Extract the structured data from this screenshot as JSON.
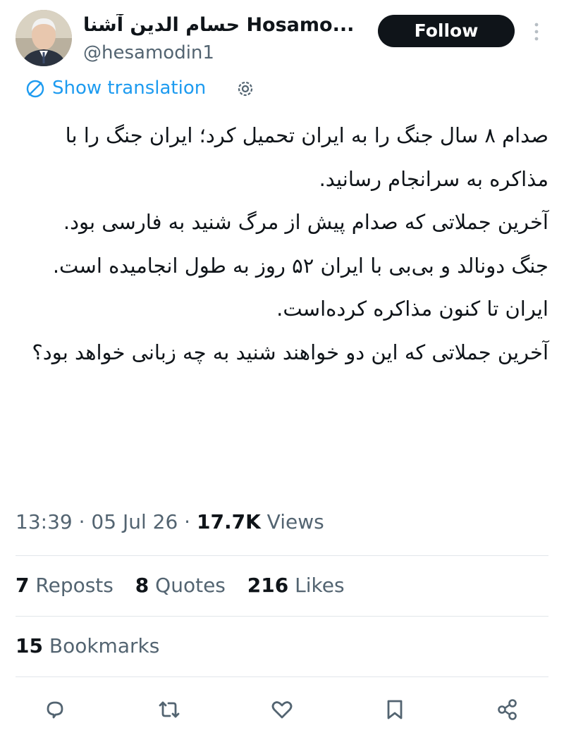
{
  "author": {
    "display_name": "حسام الدین آشنا Hosamo...",
    "handle": "@hesamodin1",
    "follow_label": "Follow",
    "avatar_icon": "avatar-photo"
  },
  "translation": {
    "label": "Show translation",
    "icon": "translate-icon",
    "settings_icon": "gear-icon",
    "color": "#1d9bf0"
  },
  "tweet": {
    "paragraphs": [
      "صدام ۸ سال جنگ را به ایران تحمیل کرد؛ ایران جنگ را با  مذاکره به سرانجام رسانید.",
      "آخرین جملاتی که صدام پیش از مرگ شنید به فارسی بود.",
      "جنگ دونالد و بی‌بی با ایران ۵۲ روز به طول انجامیده است.",
      "ایران تا کنون مذاکره کرده‌است.",
      "آخرین جملاتی که این دو خواهند شنید به چه زبانی خواهد بود؟"
    ]
  },
  "meta": {
    "time": "13:39",
    "separator": "·",
    "date": "05 Jul 26",
    "views_count": "17.7K",
    "views_label": "Views"
  },
  "stats": {
    "reposts_count": "7",
    "reposts_label": "Reposts",
    "quotes_count": "8",
    "quotes_label": "Quotes",
    "likes_count": "216",
    "likes_label": "Likes",
    "bookmarks_count": "15",
    "bookmarks_label": "Bookmarks"
  },
  "actions": [
    "reply-icon",
    "repost-icon",
    "like-icon",
    "bookmark-icon",
    "share-icon"
  ],
  "colors": {
    "text": "#0f1419",
    "secondary": "#536471",
    "link": "#1d9bf0",
    "button_bg": "#0f1419"
  }
}
